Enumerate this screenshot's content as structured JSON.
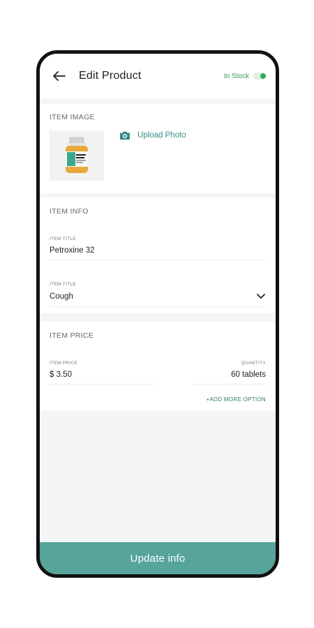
{
  "header": {
    "title": "Edit Product",
    "stock_label": "In Stock",
    "back_icon": "arrow-left-icon"
  },
  "image_section": {
    "title": "ITEM IMAGE",
    "upload_label": "Upload Photo",
    "upload_icon": "camera-icon"
  },
  "info_section": {
    "title": "ITEM INFO",
    "field1_label": "ITEM TITLE",
    "field1_value": "Petroxine 32",
    "field2_label": "ITEM TITLE",
    "field2_value": "Cough"
  },
  "price_section": {
    "title": "ITEM PRICE",
    "price_label": "ITEM PRICE",
    "price_value": "$ 3.50",
    "quantity_label": "QUANTITY",
    "quantity_value": "60 tablets",
    "add_more": "+ADD MORE OPTION"
  },
  "footer": {
    "button_label": "Update info"
  },
  "colors": {
    "accent": "#56a49a",
    "stock_green": "#2db04f",
    "link_teal": "#3a8c86"
  }
}
